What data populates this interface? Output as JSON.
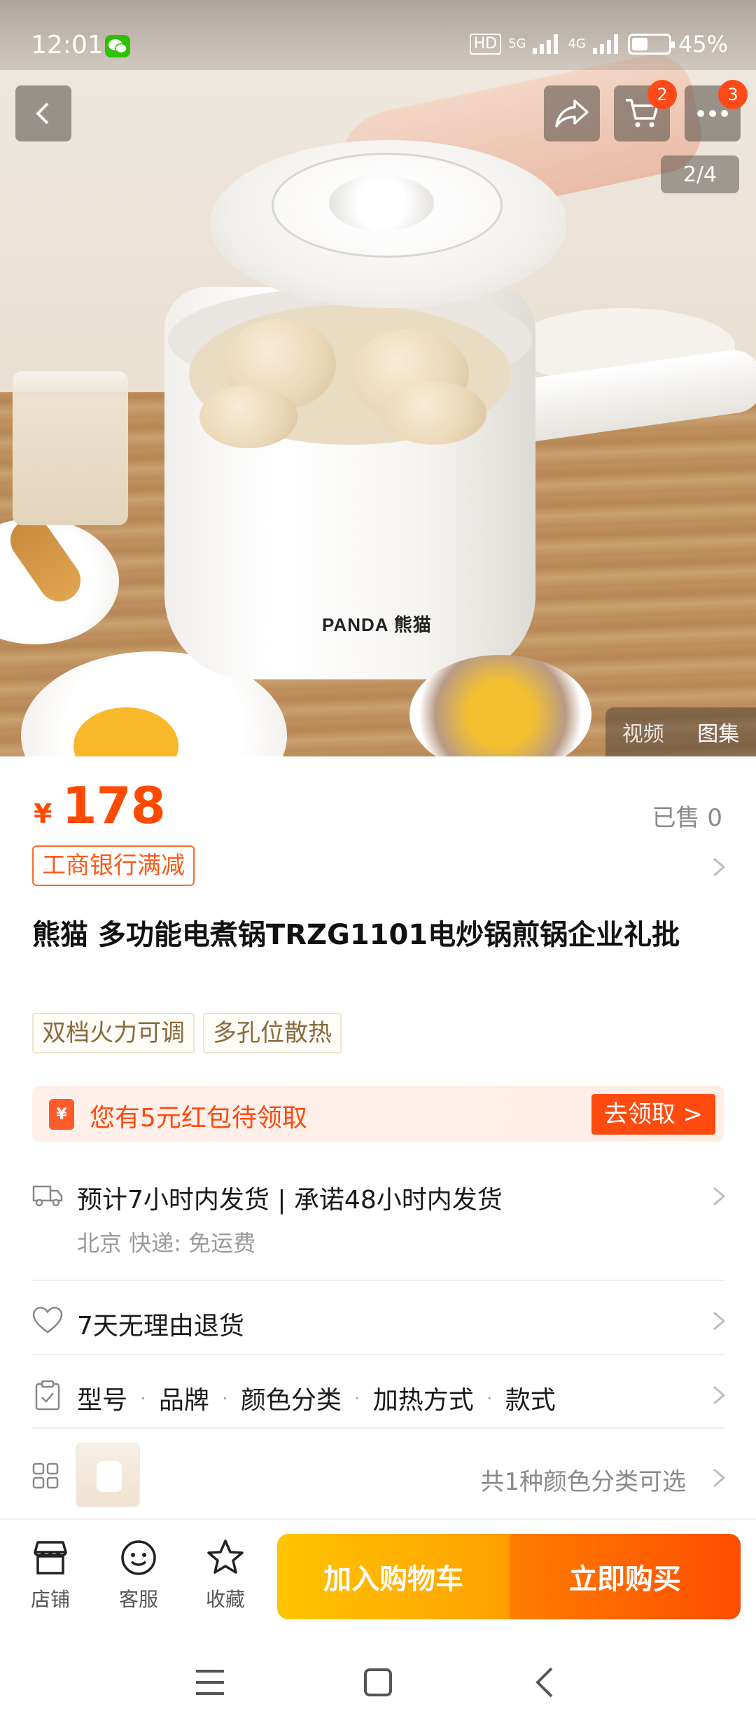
{
  "status_bar": {
    "time": "12:01",
    "hd": "HD",
    "net1": "5G",
    "net2": "4G",
    "battery_percent": "45%",
    "battery_level": 0.45
  },
  "top_nav": {
    "cart_badge": "2",
    "more_badge": "3",
    "page_indicator": "2/4"
  },
  "gallery": {
    "brand_print": "PANDA 熊猫",
    "video_tab": "视频",
    "gallery_tab": "图集"
  },
  "product": {
    "price_symbol": "¥",
    "price": "178",
    "sold": "已售 0",
    "promo_tag": "工商银行满减",
    "title": "熊猫 多功能电煮锅TRZG1101电炒锅煎锅企业礼批",
    "feature_tags": [
      "双档火力可调",
      "多孔位散热"
    ]
  },
  "coupon": {
    "icon_text": "¥",
    "text": "您有5元红包待领取",
    "button": "去领取 >"
  },
  "shipping": {
    "main": "预计7小时内发货 | 承诺48小时内发货",
    "sub": "北京  快递:  免运费"
  },
  "returns": {
    "text": "7天无理由退货"
  },
  "specs": {
    "items": [
      "型号",
      "品牌",
      "颜色分类",
      "加热方式",
      "款式"
    ]
  },
  "variants": {
    "count_text": "共1种颜色分类可选"
  },
  "action_bar": {
    "shop_label": "店铺",
    "service_label": "客服",
    "favorite_label": "收藏",
    "add_to_cart": "加入购物车",
    "buy_now": "立即购买"
  },
  "colors": {
    "accent": "#ff4a00",
    "cart_button": "#ffb000",
    "buy_button": "#ff5a00"
  }
}
